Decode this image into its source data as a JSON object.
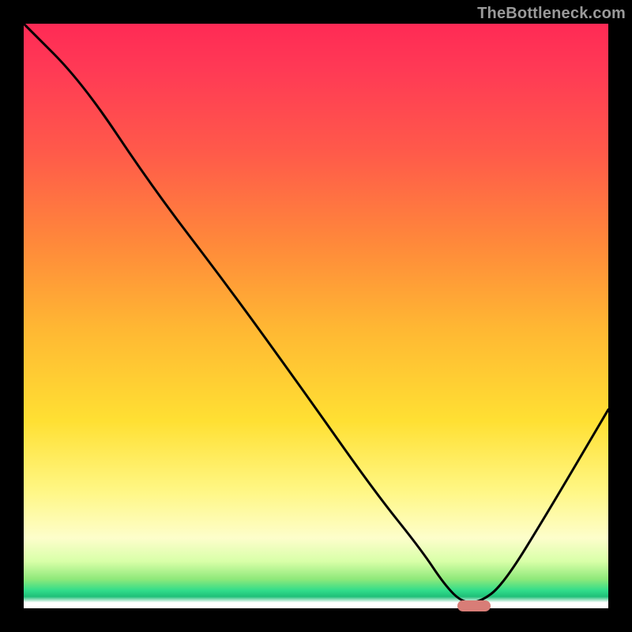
{
  "attribution": "TheBottleneck.com",
  "colors": {
    "marker": "#d87d77",
    "curve": "#000000"
  },
  "chart_data": {
    "type": "line",
    "title": "",
    "xlabel": "",
    "ylabel": "",
    "xlim": [
      0,
      100
    ],
    "ylim": [
      0,
      100
    ],
    "grid": false,
    "annotations": [
      {
        "type": "pill",
        "x": 77,
        "y": 0,
        "note": "red rounded marker at curve minimum"
      }
    ],
    "series": [
      {
        "name": "bottleneck-curve",
        "x": [
          0,
          10,
          22,
          35,
          48,
          60,
          68,
          72,
          75,
          78,
          82,
          90,
          100
        ],
        "y": [
          100,
          90,
          72,
          55,
          37,
          20,
          10,
          4,
          1,
          1,
          4,
          17,
          34
        ]
      }
    ],
    "background_gradient_stops": [
      {
        "pct": 0,
        "color": "#ff2a55"
      },
      {
        "pct": 22,
        "color": "#ff5a4a"
      },
      {
        "pct": 38,
        "color": "#ff8a3a"
      },
      {
        "pct": 52,
        "color": "#ffb733"
      },
      {
        "pct": 68,
        "color": "#ffe033"
      },
      {
        "pct": 88,
        "color": "#fdfecb"
      },
      {
        "pct": 95,
        "color": "#8fe97a"
      },
      {
        "pct": 99,
        "color": "#ffffff"
      }
    ]
  }
}
